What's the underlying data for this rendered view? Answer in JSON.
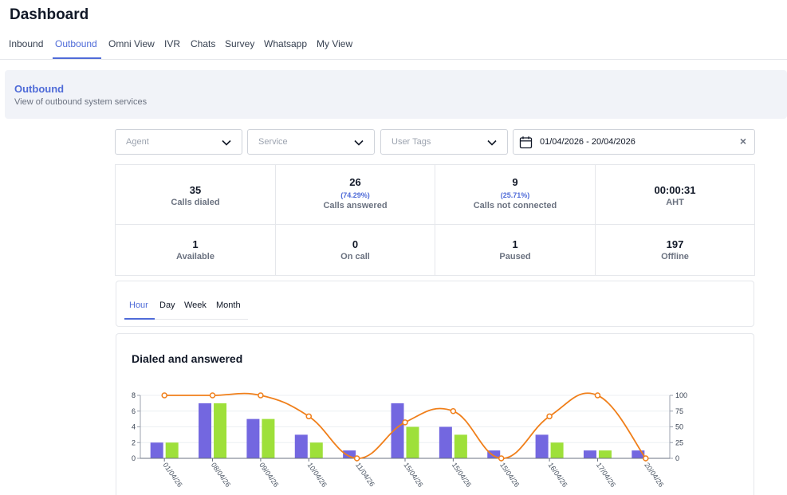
{
  "header": {
    "title": "Dashboard"
  },
  "tabs": [
    {
      "label": "Inbound",
      "active": false
    },
    {
      "label": "Outbound",
      "active": true
    },
    {
      "label": "Omni View",
      "active": false
    },
    {
      "label": "IVR",
      "active": false
    },
    {
      "label": "Chats",
      "active": false
    },
    {
      "label": "Survey",
      "active": false
    },
    {
      "label": "Whatsapp",
      "active": false
    },
    {
      "label": "My View",
      "active": false
    }
  ],
  "section": {
    "title": "Outbound",
    "subtitle": "View of outbound system services"
  },
  "filters": {
    "agent_placeholder": "Agent",
    "service_placeholder": "Service",
    "user_tags_placeholder": "User Tags",
    "date_range": "01/04/2026 - 20/04/2026",
    "clear_symbol": "×"
  },
  "stats": {
    "calls_dialed": {
      "value": "35",
      "label": "Calls dialed"
    },
    "calls_answered": {
      "value": "26",
      "pct": "(74.29%)",
      "label": "Calls answered"
    },
    "calls_not_connected": {
      "value": "9",
      "pct": "(25.71%)",
      "label": "Calls not connected"
    },
    "aht": {
      "value": "00:00:31",
      "label": "AHT"
    },
    "available": {
      "value": "1",
      "label": "Available"
    },
    "on_call": {
      "value": "0",
      "label": "On call"
    },
    "paused": {
      "value": "1",
      "label": "Paused"
    },
    "offline": {
      "value": "197",
      "label": "Offline"
    }
  },
  "time_tabs": [
    {
      "label": "Hour",
      "active": true
    },
    {
      "label": "Day",
      "active": false
    },
    {
      "label": "Week",
      "active": false
    },
    {
      "label": "Month",
      "active": false
    }
  ],
  "chart": {
    "title": "Dialed and answered"
  },
  "chart_data": {
    "type": "bar",
    "categories": [
      "01/04/26",
      "08/04/26",
      "09/04/26",
      "10/04/26",
      "11/04/26",
      "15/04/26",
      "15/04/26",
      "15/04/26",
      "16/04/26",
      "17/04/26",
      "20/04/26"
    ],
    "series": [
      {
        "kind": "bar",
        "axis": "left",
        "color": "#7367e0",
        "values": [
          2,
          7,
          5,
          3,
          1,
          7,
          4,
          1,
          3,
          1,
          1
        ]
      },
      {
        "kind": "bar",
        "axis": "left",
        "color": "#9ee03a",
        "values": [
          2,
          7,
          5,
          2,
          0,
          4,
          3,
          0,
          2,
          1,
          0
        ]
      },
      {
        "kind": "line",
        "axis": "right",
        "color": "#f07f1a",
        "values": [
          100,
          100,
          100,
          66.67,
          0,
          57.14,
          75,
          0,
          66.67,
          100,
          0
        ]
      }
    ],
    "y_left": {
      "ticks": [
        0,
        2,
        4,
        6,
        8
      ],
      "min": 0,
      "max": 8
    },
    "y_right": {
      "ticks": [
        0,
        25,
        50,
        75,
        100
      ],
      "min": 0,
      "max": 100
    },
    "grid": true
  },
  "colors": {
    "accent": "#4f6bd8",
    "bar_dialed": "#7367e0",
    "bar_answered": "#9ee03a",
    "line_rate": "#f07f1a"
  }
}
